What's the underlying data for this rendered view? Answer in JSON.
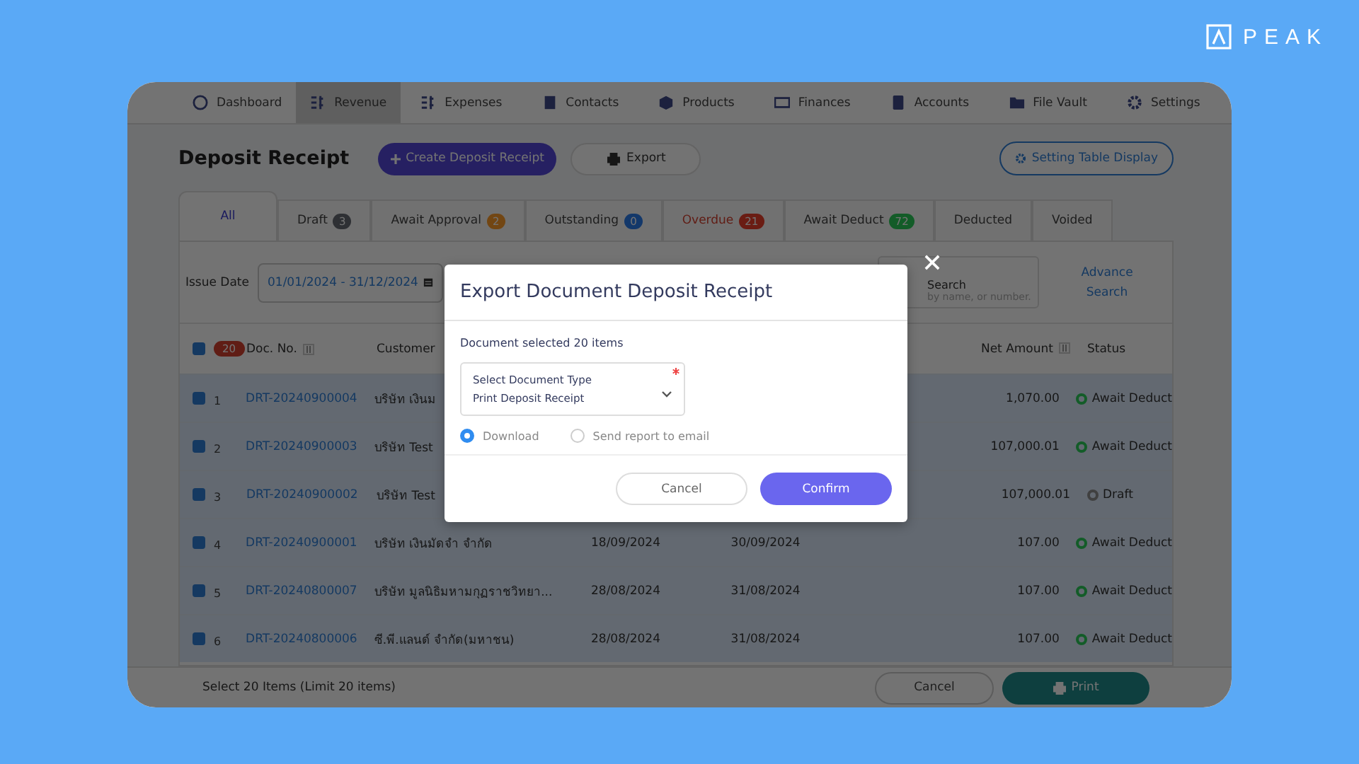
{
  "logo": {
    "text": "PEAK"
  },
  "nav": [
    {
      "label": "Dashboard",
      "selected": false
    },
    {
      "label": "Revenue",
      "selected": true
    },
    {
      "label": "Expenses",
      "selected": false
    },
    {
      "label": "Contacts",
      "selected": false
    },
    {
      "label": "Products",
      "selected": false
    },
    {
      "label": "Finances",
      "selected": false
    },
    {
      "label": "Accounts",
      "selected": false
    },
    {
      "label": "File Vault",
      "selected": false
    },
    {
      "label": "Settings",
      "selected": false
    }
  ],
  "page": {
    "title": "Deposit Receipt",
    "create_button": "Create Deposit Receipt",
    "export_button": "Export",
    "table_settings_button": "Setting Table Display"
  },
  "tabs": [
    {
      "label": "All",
      "selected": true
    },
    {
      "label": "Draft",
      "count": "3",
      "color": "#2e3034",
      "selected": false
    },
    {
      "label": "Await Approval",
      "count": "2",
      "color": "#724614",
      "selected": false
    },
    {
      "label": "Outstanding",
      "count": "0",
      "color": "#14386a",
      "selected": false
    },
    {
      "label": "Overdue",
      "count": "21",
      "color": "#6a1c14",
      "selected": false,
      "alert": true
    },
    {
      "label": "Await Deduct",
      "count": "72",
      "color": "#145c28",
      "selected": false
    },
    {
      "label": "Deducted",
      "selected": false
    },
    {
      "label": "Voided",
      "selected": false
    }
  ],
  "filter": {
    "label": "Issue Date",
    "date_range": "01/01/2024 - 31/12/2024",
    "search_label": "Search",
    "search_placeholder": "by name, or number.",
    "advance_search": "Advance Search"
  },
  "table": {
    "all_checked": true,
    "selected_count": "20",
    "columns": [
      "Doc. No.",
      "Customer",
      "Net Amount",
      "Status"
    ],
    "rows": [
      {
        "checked": true,
        "index": "1",
        "doc_no": "DRT-20240900004",
        "customer": "บริษัท เงินม",
        "net_amount": "1,070.00",
        "status": "Await Deduct",
        "color": "#145c28"
      },
      {
        "checked": true,
        "index": "2",
        "doc_no": "DRT-20240900003",
        "customer": "บริษัท Test",
        "net_amount": "107,000.01",
        "status": "Await Deduct",
        "color": "#145c28"
      },
      {
        "checked": true,
        "index": "3",
        "doc_no": "DRT-20240900002",
        "customer": "บริษัท Test",
        "net_amount": "107,000.01",
        "status": "Draft",
        "color": "#404040"
      },
      {
        "checked": true,
        "index": "4",
        "doc_no": "DRT-20240900001",
        "customer": "บริษัท เงินมัดจำ จำกัด",
        "issue_date": "18/09/2024",
        "due_date": "30/09/2024",
        "net_amount": "107.00",
        "status": "Await Deduct",
        "color": "#145c28"
      },
      {
        "checked": true,
        "index": "5",
        "doc_no": "DRT-20240800007",
        "customer": "บริษัท มูลนิธิมหามกุฏราชวิทยา...",
        "issue_date": "28/08/2024",
        "due_date": "31/08/2024",
        "net_amount": "107.00",
        "status": "Await Deduct",
        "color": "#145c28"
      },
      {
        "checked": true,
        "index": "6",
        "doc_no": "DRT-20240800006",
        "customer": "ซี.พี.แลนด์ จำกัด(มหาชน)",
        "issue_date": "28/08/2024",
        "due_date": "31/08/2024",
        "net_amount": "107.00",
        "status": "Await Deduct",
        "color": "#145c28"
      }
    ]
  },
  "footer": {
    "selection_text": "Select 20 Items (Limit 20 items)",
    "cancel_button": "Cancel",
    "print_button": "Print"
  },
  "modal": {
    "title": "Export Document Deposit Receipt",
    "selected_text": "Document selected 20 items",
    "select_label": "Select Document Type",
    "select_value": "Print Deposit Receipt",
    "required": true,
    "options": [
      {
        "label": "Download",
        "selected": true
      },
      {
        "label": "Send report to email",
        "selected": false
      }
    ],
    "cancel_button": "Cancel",
    "confirm_button": "Confirm"
  }
}
